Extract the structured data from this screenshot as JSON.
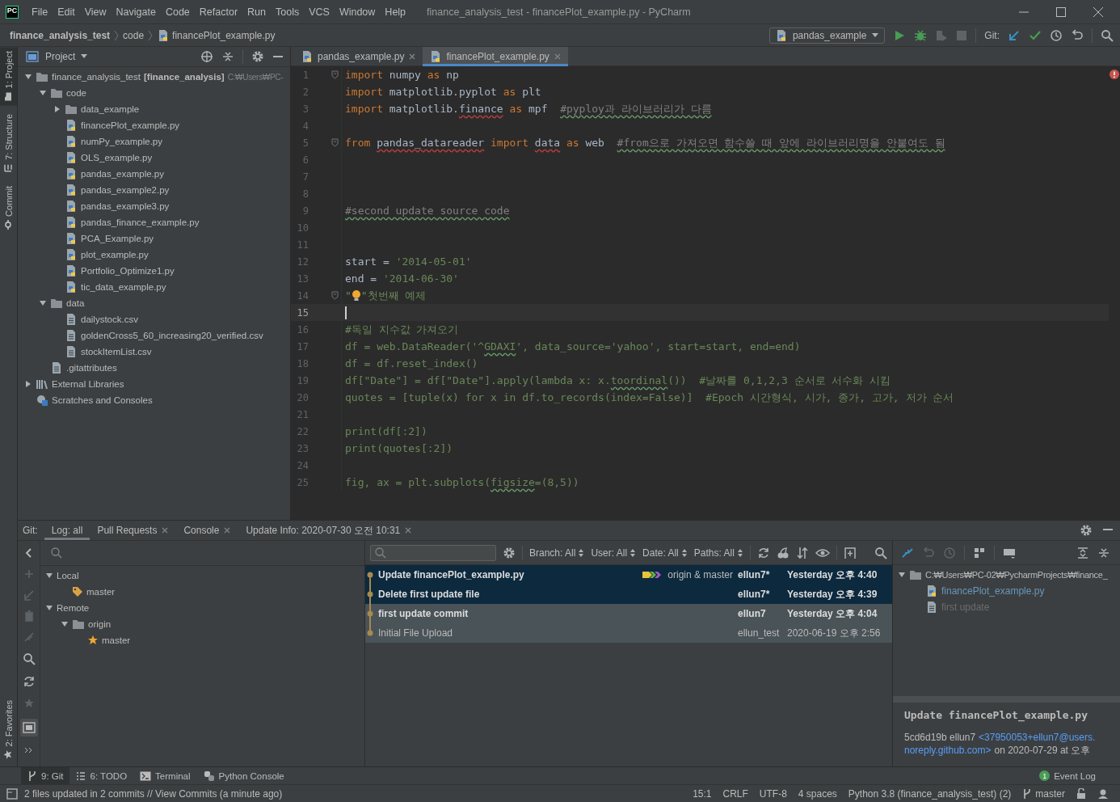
{
  "title_bar": {
    "logo": "PC",
    "menu": [
      "File",
      "Edit",
      "View",
      "Navigate",
      "Code",
      "Refactor",
      "Run",
      "Tools",
      "VCS",
      "Window",
      "Help"
    ],
    "title": "finance_analysis_test - financePlot_example.py - PyCharm"
  },
  "nav_bar": {
    "breadcrumbs": [
      {
        "label": "finance_analysis_test",
        "kind": "project"
      },
      {
        "label": "code",
        "kind": "folder"
      },
      {
        "label": "financePlot_example.py",
        "kind": "python"
      }
    ],
    "run_config": "pandas_example",
    "stop_disabled": true,
    "vcs_label": "Git:"
  },
  "side_stripe": {
    "top": [
      {
        "label": "1: Project",
        "kind": "project",
        "selected": true
      },
      {
        "label": "7: Structure",
        "kind": "structure",
        "selected": false
      },
      {
        "label": "Commit",
        "kind": "commit",
        "selected": false
      }
    ],
    "bottom": [
      {
        "label": "2: Favorites",
        "kind": "favorites",
        "selected": false
      }
    ]
  },
  "project_panel": {
    "title": "Project",
    "tree": [
      {
        "label": "finance_analysis_test",
        "module": "[finance_analysis]",
        "path": "C:₩Users₩PC-",
        "kind": "folder",
        "expanded": true,
        "children": [
          {
            "label": "code",
            "kind": "folder",
            "expanded": true,
            "children": [
              {
                "label": "data_example",
                "kind": "folder",
                "expanded": false
              },
              {
                "label": "financePlot_example.py",
                "kind": "python"
              },
              {
                "label": "numPy_example.py",
                "kind": "python"
              },
              {
                "label": "OLS_example.py",
                "kind": "python"
              },
              {
                "label": "pandas_example.py",
                "kind": "python"
              },
              {
                "label": "pandas_example2.py",
                "kind": "python"
              },
              {
                "label": "pandas_example3.py",
                "kind": "python"
              },
              {
                "label": "pandas_finance_example.py",
                "kind": "python"
              },
              {
                "label": "PCA_Example.py",
                "kind": "python"
              },
              {
                "label": "plot_example.py",
                "kind": "python"
              },
              {
                "label": "Portfolio_Optimize1.py",
                "kind": "python"
              },
              {
                "label": "tic_data_example.py",
                "kind": "python"
              }
            ]
          },
          {
            "label": "data",
            "kind": "folder",
            "expanded": true,
            "children": [
              {
                "label": "dailystock.csv",
                "kind": "text"
              },
              {
                "label": "goldenCross5_60_increasing20_verified.csv",
                "kind": "text"
              },
              {
                "label": "stockItemList.csv",
                "kind": "text"
              }
            ]
          },
          {
            "label": ".gitattributes",
            "kind": "text"
          }
        ]
      },
      {
        "label": "External Libraries",
        "kind": "library",
        "expanded": false
      },
      {
        "label": "Scratches and Consoles",
        "kind": "scratches"
      }
    ]
  },
  "editor": {
    "tabs": [
      {
        "label": "pandas_example.py",
        "selected": false
      },
      {
        "label": "financePlot_example.py",
        "selected": true
      }
    ],
    "lines": [
      {
        "number": "1",
        "fold": true,
        "current": false,
        "tokens": [
          {
            "kind": "keyword",
            "text": "import"
          },
          {
            "kind": "plain",
            "text": " numpy "
          },
          {
            "kind": "keyword",
            "text": "as"
          },
          {
            "kind": "plain",
            "text": " np"
          }
        ]
      },
      {
        "number": "2",
        "fold": false,
        "current": false,
        "tokens": [
          {
            "kind": "keyword",
            "text": "import"
          },
          {
            "kind": "plain",
            "text": " matplotlib.pyplot "
          },
          {
            "kind": "keyword",
            "text": "as"
          },
          {
            "kind": "plain",
            "text": " plt"
          }
        ]
      },
      {
        "number": "3",
        "fold": false,
        "current": false,
        "tokens": [
          {
            "kind": "keyword",
            "text": "import"
          },
          {
            "kind": "plain",
            "text": " matplotlib."
          },
          {
            "kind": "plain",
            "text": "finance",
            "unresolved": true
          },
          {
            "kind": "keyword",
            "text": " as"
          },
          {
            "kind": "plain",
            "text": " mpf  "
          },
          {
            "kind": "comment",
            "text": "#pyploy과 라이브러리가 다름",
            "misspelled": true
          }
        ]
      },
      {
        "number": "4",
        "fold": false,
        "current": false
      },
      {
        "number": "5",
        "fold": true,
        "current": false,
        "tokens": [
          {
            "kind": "keyword",
            "text": "from "
          },
          {
            "kind": "plain",
            "text": "pandas_datareader",
            "unresolved": true
          },
          {
            "kind": "keyword",
            "text": " import "
          },
          {
            "kind": "plain",
            "text": "data",
            "unresolved": true
          },
          {
            "kind": "keyword",
            "text": " as"
          },
          {
            "kind": "plain",
            "text": " web  "
          },
          {
            "kind": "comment",
            "text": "#from으로 가져오면 함수쓸 때 앞에 라이브러리명을 안붙여도 됨",
            "misspelled": true
          }
        ]
      },
      {
        "number": "6",
        "fold": false,
        "current": false
      },
      {
        "number": "7",
        "fold": false,
        "current": false
      },
      {
        "number": "8",
        "fold": false,
        "current": false
      },
      {
        "number": "9",
        "fold": false,
        "current": false,
        "tokens": [
          {
            "kind": "comment",
            "text": "#second update source code",
            "misspelled": true
          }
        ]
      },
      {
        "number": "10",
        "fold": false,
        "current": false
      },
      {
        "number": "11",
        "fold": false,
        "current": false
      },
      {
        "number": "12",
        "fold": false,
        "current": false,
        "tokens": [
          {
            "kind": "plain",
            "text": "start = "
          },
          {
            "kind": "string",
            "text": "'2014-05-01'"
          }
        ]
      },
      {
        "number": "13",
        "fold": false,
        "current": false,
        "tokens": [
          {
            "kind": "plain",
            "text": "end = "
          },
          {
            "kind": "string",
            "text": "'2014-06-30'"
          }
        ]
      },
      {
        "number": "14",
        "fold": true,
        "current": false,
        "tokens": [
          {
            "kind": "string",
            "text": "\""
          },
          {
            "kind": "bulb"
          },
          {
            "kind": "string",
            "text": "\"첫번째 예제"
          }
        ]
      },
      {
        "number": "15",
        "fold": false,
        "current": true
      },
      {
        "number": "16",
        "fold": false,
        "current": false,
        "tokens": [
          {
            "kind": "string",
            "text": "#독일 지수값 가져오기"
          }
        ]
      },
      {
        "number": "17",
        "fold": false,
        "current": false,
        "tokens": [
          {
            "kind": "string",
            "text": "df = web.DataReader('^"
          },
          {
            "kind": "string",
            "text": "GDAXI",
            "misspelled": true
          },
          {
            "kind": "string",
            "text": "', data_source='yahoo', start=start, end=end)"
          }
        ]
      },
      {
        "number": "18",
        "fold": false,
        "current": false,
        "tokens": [
          {
            "kind": "string",
            "text": "df = df.reset_index()"
          }
        ]
      },
      {
        "number": "19",
        "fold": false,
        "current": false,
        "tokens": [
          {
            "kind": "string",
            "text": "df[\"Date\"] = df[\"Date\"].apply(lambda x: x."
          },
          {
            "kind": "string",
            "text": "toordinal",
            "misspelled": true
          },
          {
            "kind": "string",
            "text": "())  #날짜를 0,1,2,3 순서로 서수화 시킴"
          }
        ]
      },
      {
        "number": "20",
        "fold": false,
        "current": false,
        "tokens": [
          {
            "kind": "string",
            "text": "quotes = [tuple(x) for x in df.to_records(index=False)]  #Epoch 시간형식, 시가, 종가, 고가, 저가 순서"
          }
        ]
      },
      {
        "number": "21",
        "fold": false,
        "current": false
      },
      {
        "number": "22",
        "fold": false,
        "current": false,
        "tokens": [
          {
            "kind": "string",
            "text": "print(df[:2])"
          }
        ]
      },
      {
        "number": "23",
        "fold": false,
        "current": false,
        "tokens": [
          {
            "kind": "string",
            "text": "print(quotes[:2])"
          }
        ]
      },
      {
        "number": "24",
        "fold": false,
        "current": false
      },
      {
        "number": "25",
        "fold": false,
        "current": false,
        "tokens": [
          {
            "kind": "string",
            "text": "fig, ax = plt.subplots("
          },
          {
            "kind": "string",
            "text": "figsize",
            "misspelled": true
          },
          {
            "kind": "string",
            "text": "=(8,5))"
          }
        ]
      }
    ]
  },
  "git_panel": {
    "label": "Git:",
    "tabs": [
      {
        "label": "Log: all",
        "closable": false,
        "selected": true
      },
      {
        "label": "Pull Requests",
        "closable": true,
        "selected": false
      },
      {
        "label": "Console",
        "closable": true,
        "selected": false
      },
      {
        "label": "Update Info: 2020-07-30 오전 10:31",
        "closable": true,
        "selected": false
      }
    ],
    "branches": [
      {
        "label": "Local",
        "expanded": true,
        "children": [
          {
            "label": "master",
            "kind": "local_branch"
          }
        ]
      },
      {
        "label": "Remote",
        "expanded": true,
        "children": [
          {
            "label": "origin",
            "kind": "remote",
            "expanded": true,
            "children": [
              {
                "label": "master",
                "kind": "favorite_branch"
              }
            ]
          }
        ]
      }
    ],
    "filters": [
      "Branch: All",
      "User: All",
      "Date: All",
      "Paths: All"
    ],
    "commits": [
      {
        "subject": "Update financePlot_example.py",
        "refs": "origin & master",
        "author": "ellun7*",
        "date": "Yesterday 오후 4:40",
        "selected": true,
        "bold": true
      },
      {
        "subject": "Delete first update file",
        "author": "ellun7*",
        "date": "Yesterday 오후 4:39",
        "selected": true,
        "bold": true
      },
      {
        "subject": "first update commit",
        "author": "ellun7",
        "date": "Yesterday 오후 4:04",
        "selected": false,
        "highlighted": true,
        "bold": true
      },
      {
        "subject": "Initial File Upload",
        "author": "ellun_test",
        "date": "2020-06-19 오후 2:56",
        "selected": false,
        "highlighted": true,
        "bold": false
      }
    ],
    "changes": {
      "root": "C:₩Users₩PC-02₩PycharmProjects₩finance_",
      "files": [
        {
          "label": "financePlot_example.py",
          "kind": "modified"
        },
        {
          "label": "first update",
          "kind": "deleted"
        }
      ]
    },
    "details": {
      "subject": "Update financePlot_example.py",
      "hash_author": "5cd6d19b ellun7",
      "email_lines": [
        "<37950053+ellun7@users.",
        "noreply.github.com>"
      ],
      "date_text": "on 2020-07-29 at 오후"
    }
  },
  "tool_tabs": [
    {
      "label": "9: Git",
      "kind": "git",
      "selected": true
    },
    {
      "label": "6: TODO",
      "kind": "todo",
      "selected": false
    },
    {
      "label": "Terminal",
      "kind": "terminal",
      "selected": false
    },
    {
      "label": "Python Console",
      "kind": "python",
      "selected": false
    }
  ],
  "event_log": {
    "label": "Event Log",
    "count": "1"
  },
  "status_bar": {
    "message": "2 files updated in 2 commits // View Commits (a minute ago)",
    "items": [
      "15:1",
      "CRLF",
      "UTF-8",
      "4 spaces",
      "Python 3.8 (finance_analysis_test) (2)"
    ],
    "branch": "master"
  }
}
